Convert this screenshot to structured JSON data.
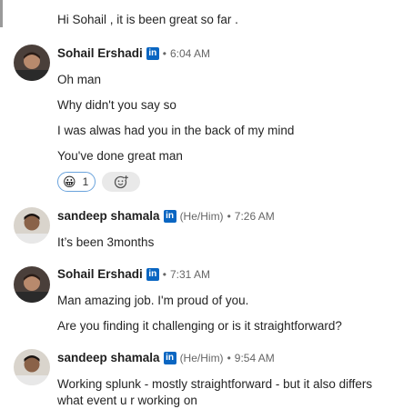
{
  "messages": [
    {
      "text": "Hi Sohail , it is been great so far ."
    },
    {
      "author": "Sohail Ershadi",
      "time": "6:04 AM",
      "lines": [
        "Oh man",
        "Why didn't you say so",
        "I was alwas had you in the back of my mind",
        "You've done great man"
      ],
      "reaction": {
        "emoji": "😀",
        "count": "1"
      }
    },
    {
      "author": "sandeep shamala",
      "pronouns": "(He/Him)",
      "time": "7:26 AM",
      "lines": [
        "It’s been 3months"
      ]
    },
    {
      "author": "Sohail Ershadi",
      "time": "7:31 AM",
      "lines": [
        "Man amazing job. I'm proud of you.",
        "Are you finding it challenging or is it straightforward?"
      ]
    },
    {
      "author": "sandeep shamala",
      "pronouns": "(He/Him)",
      "time": "9:54 AM",
      "lines": [
        "Working splunk - mostly straightforward - but it also differs what event u r working on"
      ]
    }
  ],
  "badge_text": "in",
  "separator": "•",
  "colors": {
    "linkedin_blue": "#0a66c2",
    "reaction_border": "#6aa3dc",
    "meta_gray": "#666666"
  },
  "icons": {
    "add_reaction": "add-reaction-icon",
    "premium_badge": "linkedin-badge-icon"
  }
}
